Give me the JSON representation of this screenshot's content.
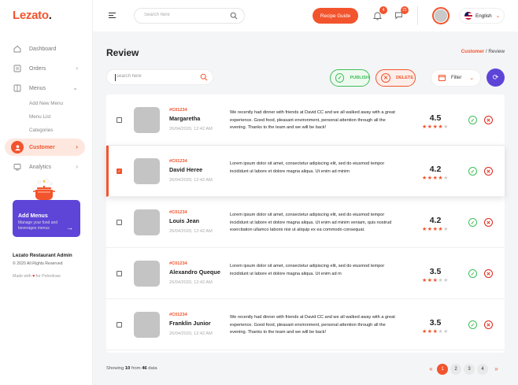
{
  "brand": {
    "logo_text": "Lezato",
    "logo_dot": "."
  },
  "sidebar": {
    "items": [
      {
        "label": "Dashboard",
        "icon": "home-icon"
      },
      {
        "label": "Orders",
        "icon": "orders-icon"
      },
      {
        "label": "Menus",
        "icon": "menu-icon"
      },
      {
        "label": "Customer",
        "icon": "customer-icon",
        "active": true
      },
      {
        "label": "Analytics",
        "icon": "analytics-icon"
      }
    ],
    "menus_sub": [
      "Add New Menu",
      "Menu List",
      "Categories"
    ],
    "promo": {
      "title": "Add Menus",
      "desc": "Manage your food and beverages menus",
      "arrow": "→"
    },
    "footer": {
      "title": "Lezato Restaurant Admin",
      "copyright": "© 2020 All Rights Reserved",
      "made_pre": "Made with",
      "heart": "♥",
      "made_post": "for Peterdraw"
    }
  },
  "topbar": {
    "search_placeholder": "Search here",
    "recipe_button": "Recipe Guide",
    "notif_count": "4",
    "message_count": "21",
    "language": "English"
  },
  "page": {
    "title": "Review",
    "breadcrumb_current_section": "Customer",
    "breadcrumb_sep": "/",
    "breadcrumb_page": "Review",
    "search_placeholder": "search here",
    "publish_label": "PUBLISH",
    "delete_label": "DELETE",
    "filter_label": "Filter"
  },
  "reviews": [
    {
      "id": "#C01234",
      "name": "Margaretha",
      "date": "26/04/2020, 12:42 AM",
      "text": "We recently had dinner with friends at David CC and we all walked away with a great experience. Good food, pleasant environment, personal attention through all the evening. Thanks to the team and we will be back!",
      "score": "4.5",
      "stars": 4,
      "checked": false
    },
    {
      "id": "#C01234",
      "name": "David Heree",
      "date": "26/04/2020, 12:42 AM",
      "text": "Lorem ipsum dolor sit amet, consectetur adipiscing elit, sed do eiusmod tempor incididunt ut labore et dolore magna aliqua. Ut enim ad minim",
      "score": "4.2",
      "stars": 4,
      "checked": true
    },
    {
      "id": "#C01234",
      "name": "Louis Jean",
      "date": "26/04/2020, 12:42 AM",
      "text": "Lorem ipsum dolor sit amet, consectetur adipiscing elit, sed do eiusmod tempor incididunt ut labore et dolore magna aliqua. Ut enim ad minim veniam, quis nostrud exercitation ullamco laboris nisi ut aliquip ex ea commodo consequat.",
      "score": "4.2",
      "stars": 4,
      "checked": false
    },
    {
      "id": "#C01234",
      "name": "Alexandro Queque",
      "date": "26/04/2020, 12:42 AM",
      "text": "Lorem ipsum dolor sit amet, consectetur adipiscing elit, sed do eiusmod tempor incididunt ut labore et dolore magna aliqua. Ut enim ad m",
      "score": "3.5",
      "stars": 3,
      "checked": false
    },
    {
      "id": "#C01234",
      "name": "Franklin Junior",
      "date": "26/04/2020, 12:42 AM",
      "text": "We recently had dinner with friends at David CC and we all walked away with a great experience. Good food, pleasant environment, personal attention through all the evening. Thanks to the team and we will be back!",
      "score": "3.5",
      "stars": 3,
      "checked": false
    }
  ],
  "pagination": {
    "showing_pre": "Showing",
    "showing_count": "10",
    "showing_mid": "from",
    "showing_total": "46",
    "showing_post": "data",
    "prev": "«",
    "next": "»",
    "pages": [
      "1",
      "2",
      "3",
      "4"
    ],
    "current": "1"
  },
  "colors": {
    "accent": "#f2542d",
    "purple": "#5e45d8",
    "green": "#3fbe5a",
    "red": "#e0261a",
    "star_off": "#cccccc"
  }
}
